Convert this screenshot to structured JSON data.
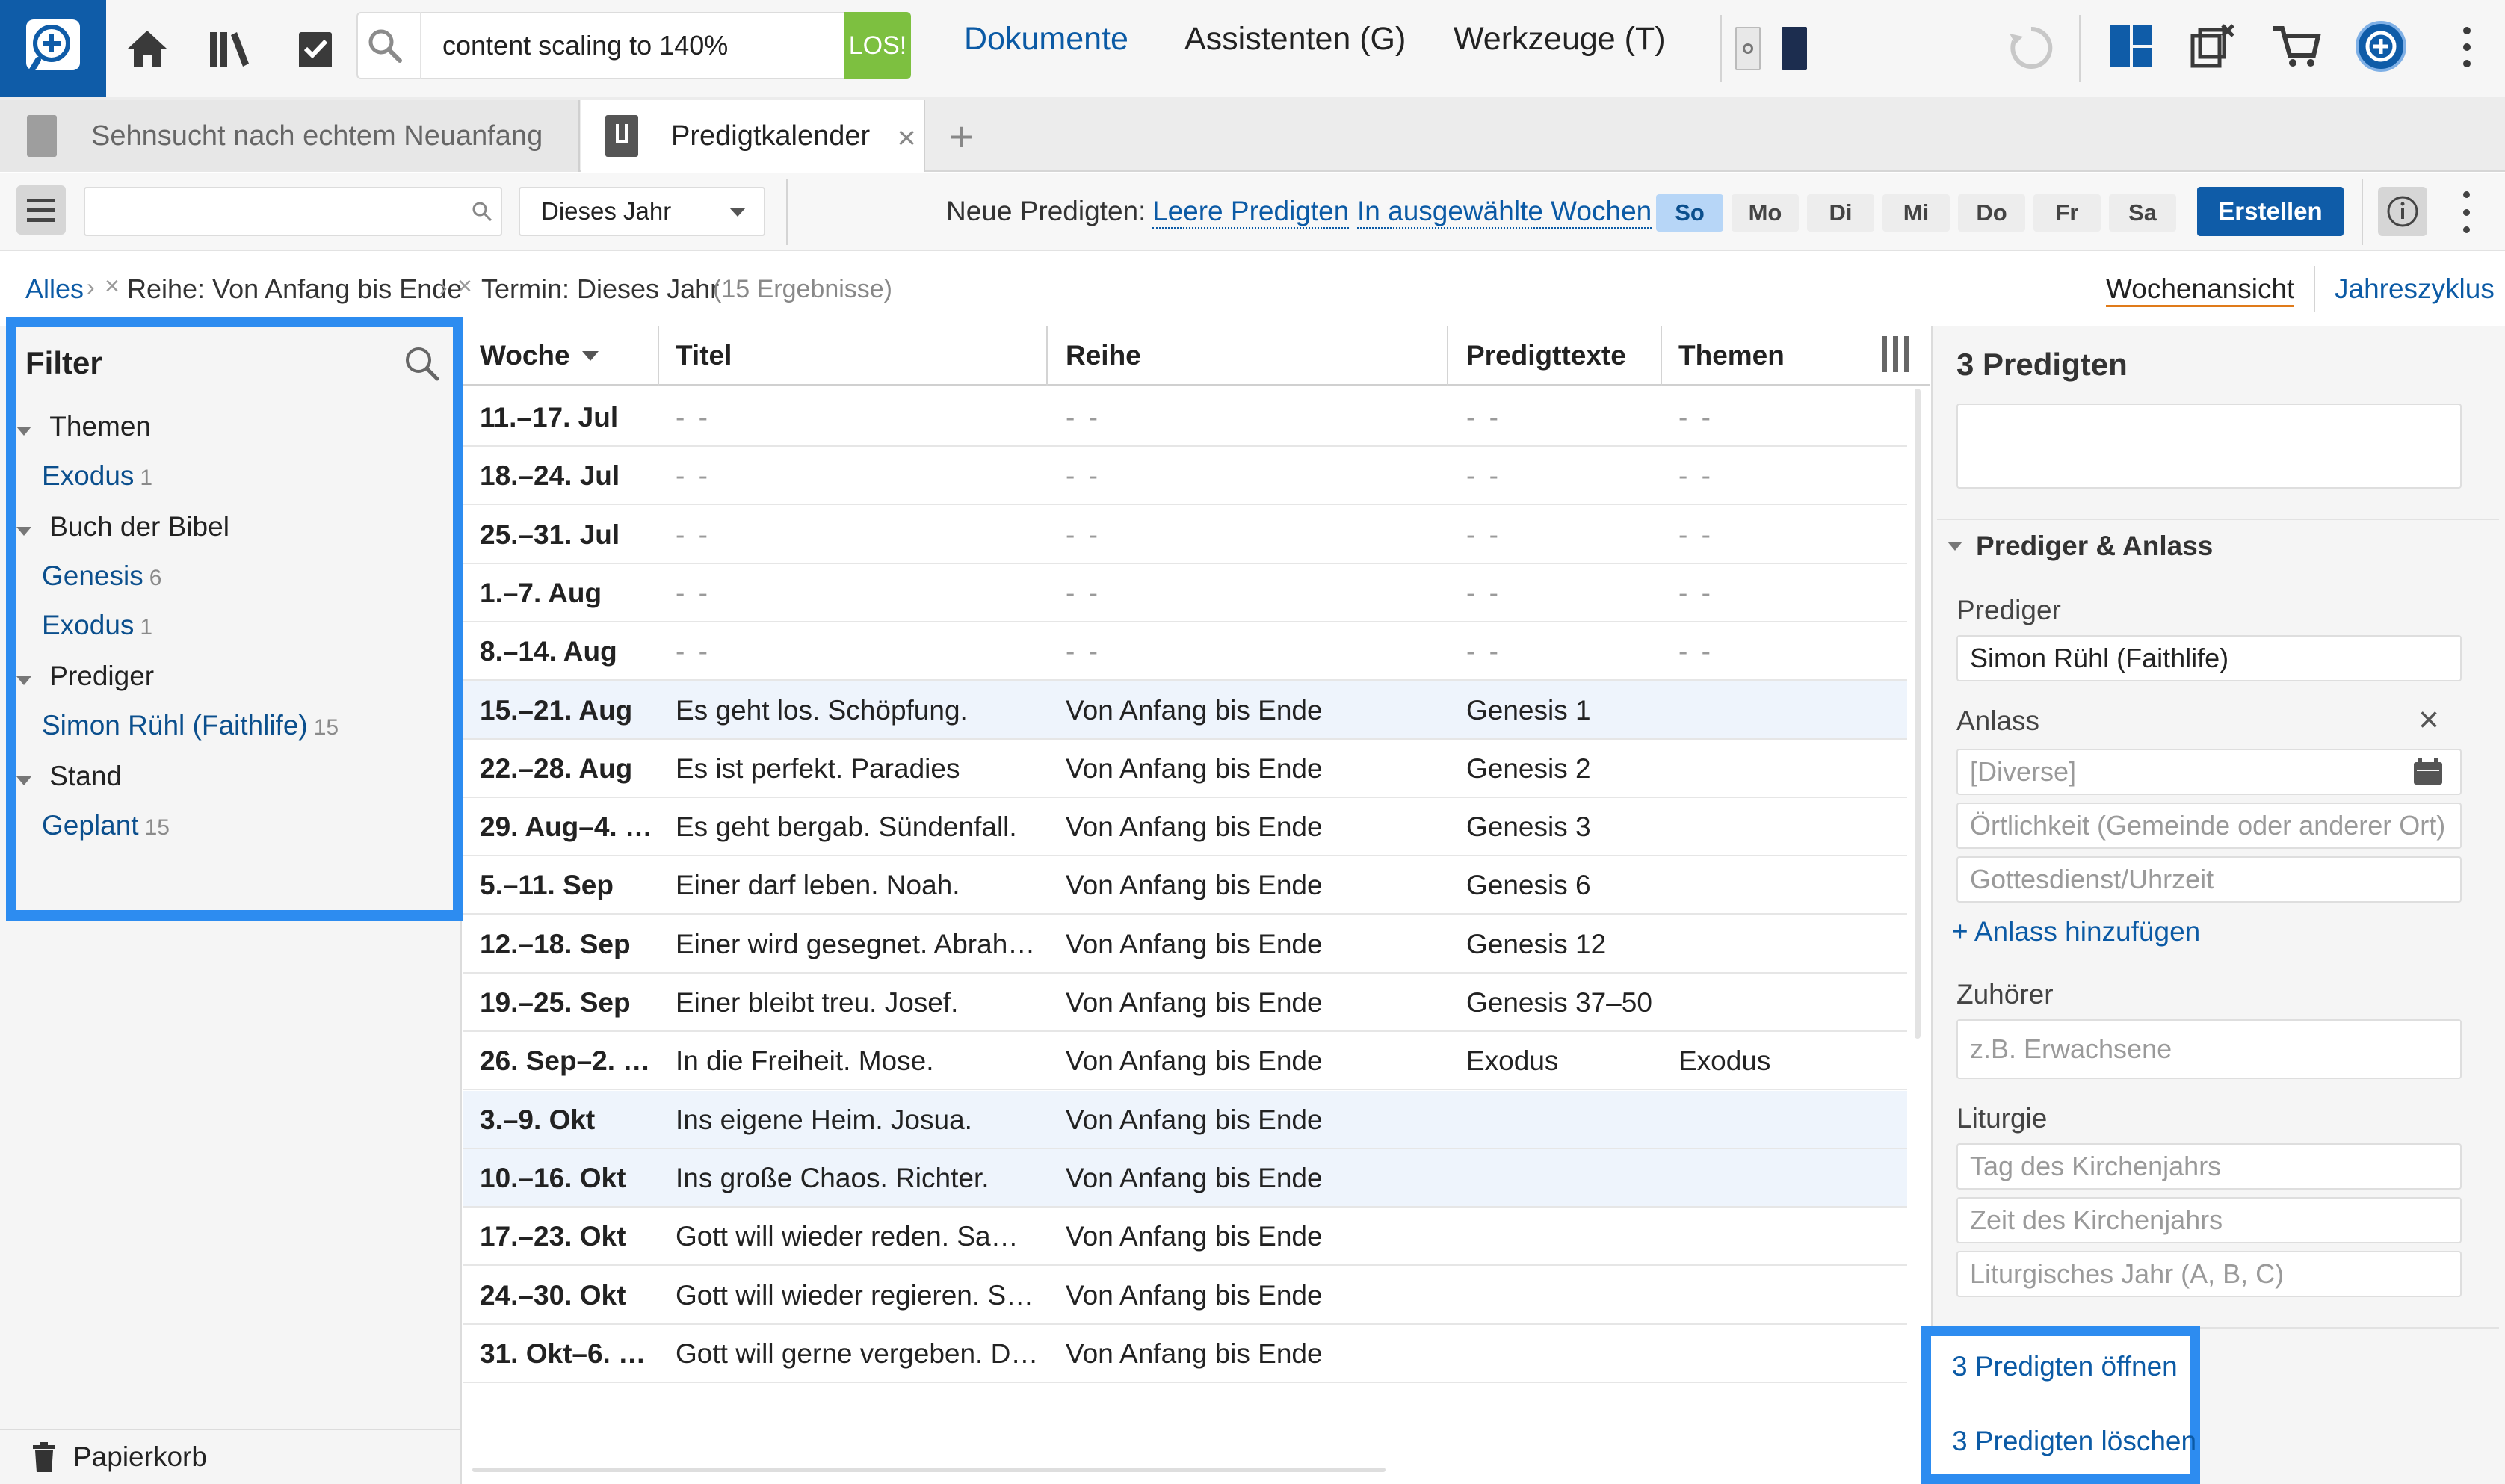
{
  "toolbar": {
    "search_value": "content scaling to 140%",
    "go_label": "LOS!",
    "menu": [
      "Dokumente",
      "Assistenten (G)",
      "Werkzeuge (T)"
    ]
  },
  "tabs": [
    {
      "label": "Sehnsucht nach echtem Neuanfang"
    },
    {
      "label": "Predigtkalender"
    }
  ],
  "panel_toolbar": {
    "period": "Dieses Jahr",
    "new_label": "Neue Predigten:",
    "empty_link": "Leere Predigten",
    "weeks_link": "In ausgewählte Wochen",
    "days": [
      "So",
      "Mo",
      "Di",
      "Mi",
      "Do",
      "Fr",
      "Sa"
    ],
    "create": "Erstellen"
  },
  "breadcrumb": {
    "root": "Alles",
    "series": "Reihe: Von Anfang bis Ende",
    "term": "Termin: Dieses Jahr",
    "results": "(15 Ergebnisse)",
    "view_week": "Wochenansicht",
    "view_year": "Jahreszyklus"
  },
  "filter": {
    "title": "Filter",
    "groups": [
      {
        "label": "Themen",
        "items": [
          {
            "label": "Exodus",
            "count": "1"
          }
        ]
      },
      {
        "label": "Buch der Bibel",
        "items": [
          {
            "label": "Genesis",
            "count": "6"
          },
          {
            "label": "Exodus",
            "count": "1"
          }
        ]
      },
      {
        "label": "Prediger",
        "items": [
          {
            "label": "Simon Rühl (Faithlife)",
            "count": "15"
          }
        ]
      },
      {
        "label": "Stand",
        "items": [
          {
            "label": "Geplant",
            "count": "15"
          }
        ]
      }
    ],
    "trash": "Papierkorb"
  },
  "table": {
    "columns": [
      "Woche",
      "Titel",
      "Reihe",
      "Predigttexte",
      "Themen"
    ],
    "rows": [
      {
        "week": "11.–17. Jul",
        "title": "- -",
        "series": "- -",
        "texts": "- -",
        "themes": "- -"
      },
      {
        "week": "18.–24. Jul",
        "title": "- -",
        "series": "- -",
        "texts": "- -",
        "themes": "- -"
      },
      {
        "week": "25.–31. Jul",
        "title": "- -",
        "series": "- -",
        "texts": "- -",
        "themes": "- -"
      },
      {
        "week": "1.–7. Aug",
        "title": "- -",
        "series": "- -",
        "texts": "- -",
        "themes": "- -"
      },
      {
        "week": "8.–14. Aug",
        "title": "- -",
        "series": "- -",
        "texts": "- -",
        "themes": "- -"
      },
      {
        "week": "15.–21. Aug",
        "title": "Es geht los. Schöpfung.",
        "series": "Von Anfang bis Ende",
        "texts": "Genesis 1",
        "themes": ""
      },
      {
        "week": "22.–28. Aug",
        "title": "Es ist perfekt. Paradies",
        "series": "Von Anfang bis Ende",
        "texts": "Genesis 2",
        "themes": ""
      },
      {
        "week": "29. Aug–4. …",
        "title": "Es geht bergab. Sündenfall.",
        "series": "Von Anfang bis Ende",
        "texts": "Genesis 3",
        "themes": ""
      },
      {
        "week": "5.–11. Sep",
        "title": "Einer darf leben. Noah.",
        "series": "Von Anfang bis Ende",
        "texts": "Genesis 6",
        "themes": ""
      },
      {
        "week": "12.–18. Sep",
        "title": "Einer wird gesegnet. Abrah…",
        "series": "Von Anfang bis Ende",
        "texts": "Genesis 12",
        "themes": ""
      },
      {
        "week": "19.–25. Sep",
        "title": "Einer bleibt treu. Josef.",
        "series": "Von Anfang bis Ende",
        "texts": "Genesis 37–50",
        "themes": ""
      },
      {
        "week": "26. Sep–2. …",
        "title": "In die Freiheit. Mose.",
        "series": "Von Anfang bis Ende",
        "texts": "Exodus",
        "themes": "Exodus"
      },
      {
        "week": "3.–9. Okt",
        "title": "Ins eigene Heim. Josua.",
        "series": "Von Anfang bis Ende",
        "texts": "",
        "themes": ""
      },
      {
        "week": "10.–16. Okt",
        "title": "Ins große Chaos. Richter.",
        "series": "Von Anfang bis Ende",
        "texts": "",
        "themes": ""
      },
      {
        "week": "17.–23. Okt",
        "title": "Gott will wieder reden. Sa…",
        "series": "Von Anfang bis Ende",
        "texts": "",
        "themes": ""
      },
      {
        "week": "24.–30. Okt",
        "title": "Gott will wieder regieren. S…",
        "series": "Von Anfang bis Ende",
        "texts": "",
        "themes": ""
      },
      {
        "week": "31. Okt–6. …",
        "title": "Gott will gerne vergeben. D…",
        "series": "Von Anfang bis Ende",
        "texts": "",
        "themes": ""
      }
    ]
  },
  "detail": {
    "title": "3 Predigten",
    "section": "Prediger & Anlass",
    "preacher_label": "Prediger",
    "preacher_value": "Simon Rühl (Faithlife)",
    "occasion_label": "Anlass",
    "occasion_ph": "[Diverse]",
    "place_ph": "Örtlichkeit (Gemeinde oder anderer Ort)",
    "service_ph": "Gottesdienst/Uhrzeit",
    "add_occasion": "+ Anlass hinzufügen",
    "audience_label": "Zuhörer",
    "audience_ph": "z.B. Erwachsene",
    "liturgy_label": "Liturgie",
    "liturgy_ph": [
      "Tag des Kirchenjahrs",
      "Zeit des Kirchenjahrs",
      "Liturgisches Jahr (A, B, C)"
    ],
    "open": "3 Predigten öffnen",
    "delete": "3 Predigten löschen"
  }
}
